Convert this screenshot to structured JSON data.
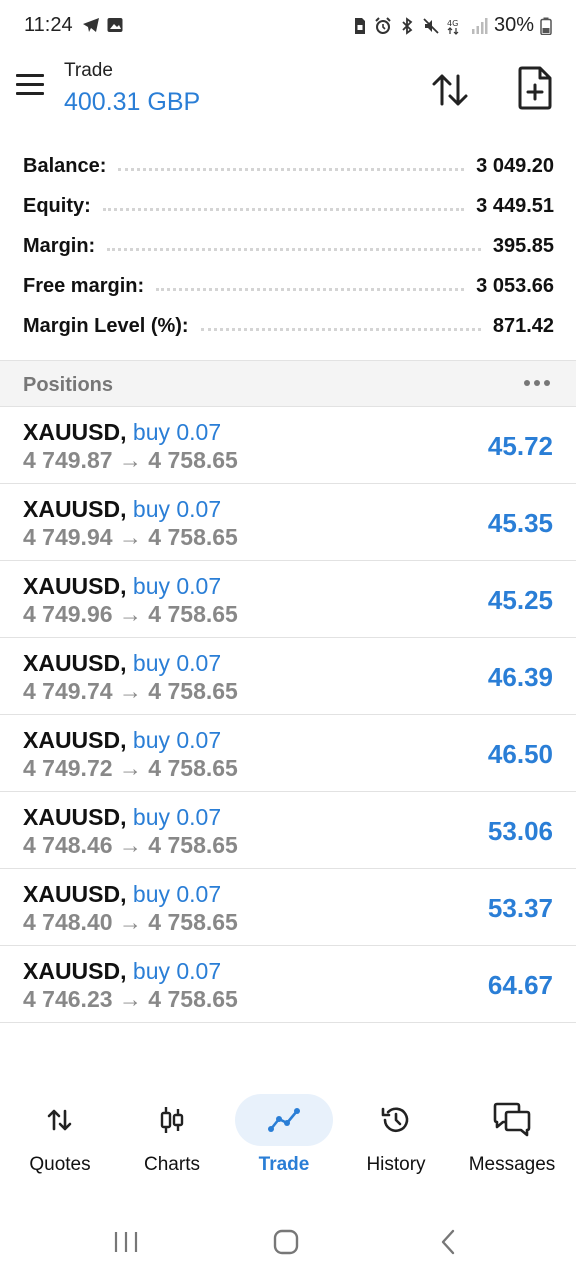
{
  "status_bar": {
    "time": "11:24",
    "battery": "30%"
  },
  "header": {
    "title": "Trade",
    "amount": "400.31 GBP"
  },
  "summary": [
    {
      "label": "Balance:",
      "value": "3 049.20"
    },
    {
      "label": "Equity:",
      "value": "3 449.51"
    },
    {
      "label": "Margin:",
      "value": "395.85"
    },
    {
      "label": "Free margin:",
      "value": "3 053.66"
    },
    {
      "label": "Margin Level (%):",
      "value": "871.42"
    }
  ],
  "positions": {
    "title": "Positions",
    "items": [
      {
        "symbol": "XAUUSD,",
        "side": "buy 0.07",
        "prices": "4 749.87 → 4 758.65",
        "profit": "45.72"
      },
      {
        "symbol": "XAUUSD,",
        "side": "buy 0.07",
        "prices": "4 749.94 → 4 758.65",
        "profit": "45.35"
      },
      {
        "symbol": "XAUUSD,",
        "side": "buy 0.07",
        "prices": "4 749.96 → 4 758.65",
        "profit": "45.25"
      },
      {
        "symbol": "XAUUSD,",
        "side": "buy 0.07",
        "prices": "4 749.74 → 4 758.65",
        "profit": "46.39"
      },
      {
        "symbol": "XAUUSD,",
        "side": "buy 0.07",
        "prices": "4 749.72 → 4 758.65",
        "profit": "46.50"
      },
      {
        "symbol": "XAUUSD,",
        "side": "buy 0.07",
        "prices": "4 748.46 → 4 758.65",
        "profit": "53.06"
      },
      {
        "symbol": "XAUUSD,",
        "side": "buy 0.07",
        "prices": "4 748.40 → 4 758.65",
        "profit": "53.37"
      },
      {
        "symbol": "XAUUSD,",
        "side": "buy 0.07",
        "prices": "4 746.23 → 4 758.65",
        "profit": "64.67"
      }
    ]
  },
  "bottom_nav": [
    {
      "label": "Quotes",
      "icon": "quotes-icon",
      "active": false
    },
    {
      "label": "Charts",
      "icon": "charts-icon",
      "active": false
    },
    {
      "label": "Trade",
      "icon": "trade-icon",
      "active": true
    },
    {
      "label": "History",
      "icon": "history-icon",
      "active": false
    },
    {
      "label": "Messages",
      "icon": "messages-icon",
      "active": false
    }
  ],
  "colors": {
    "accent": "#2a7ed6",
    "muted_text": "#888888",
    "section_bg": "#f4f4f4"
  }
}
